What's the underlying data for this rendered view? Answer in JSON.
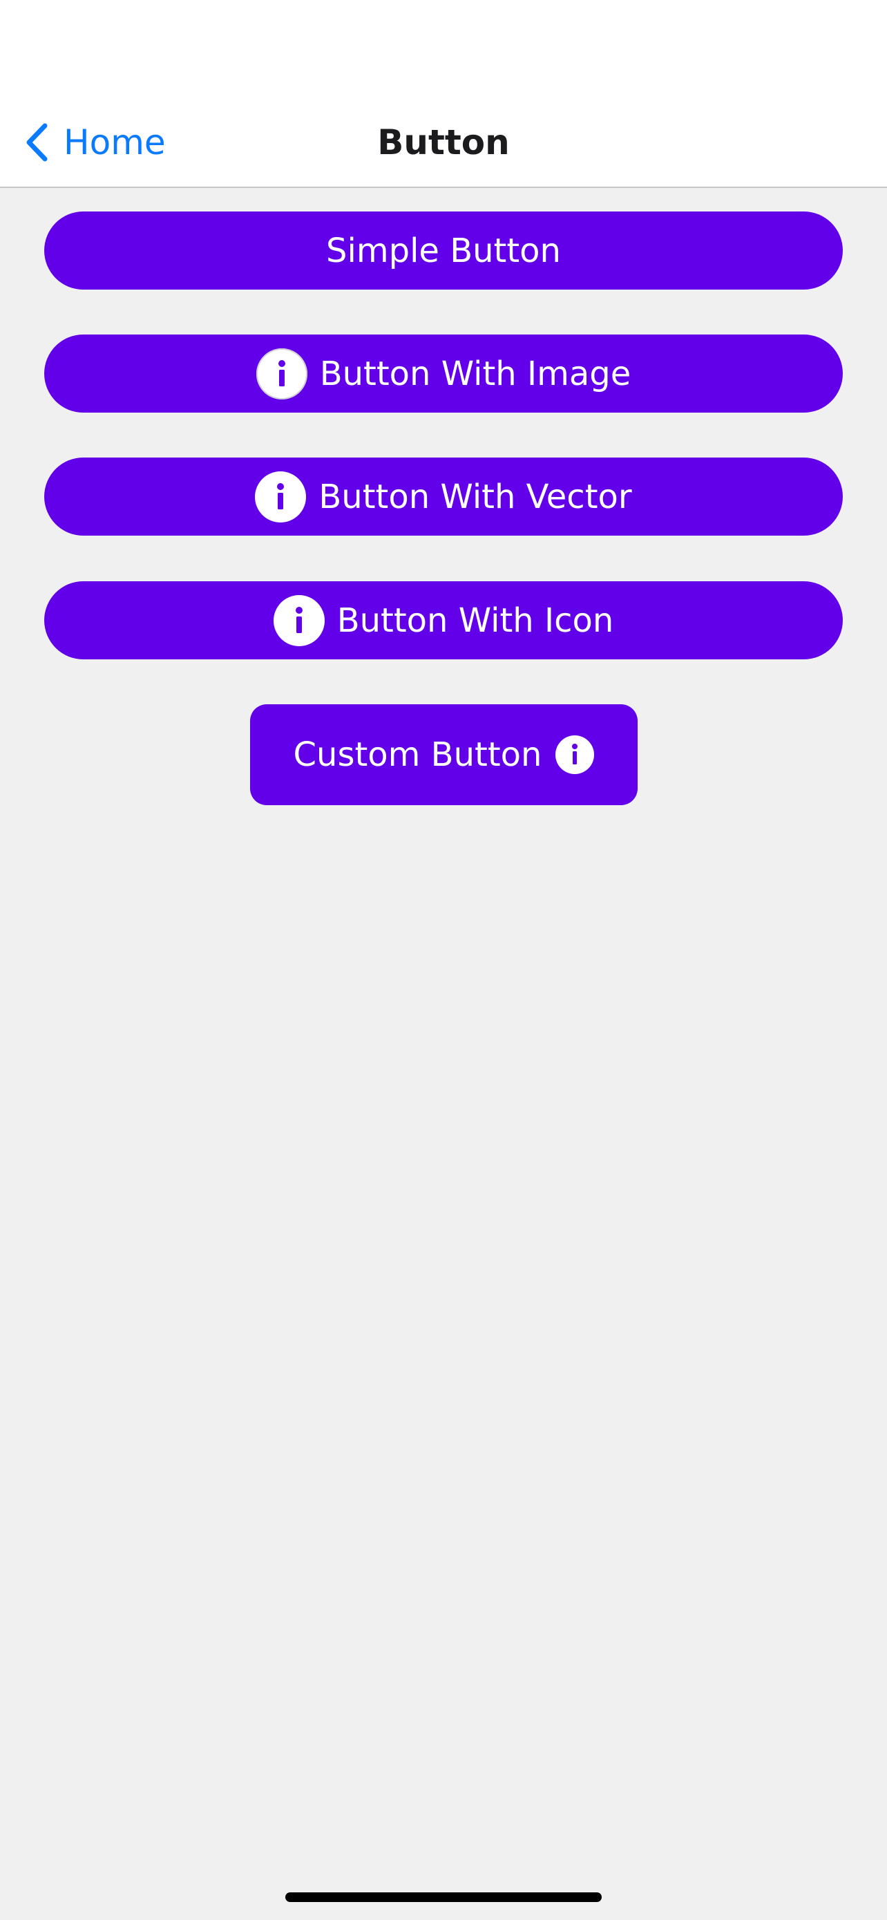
{
  "nav": {
    "back_label": "Home",
    "title": "Button"
  },
  "buttons": {
    "simple": "Simple Button",
    "with_image": "Button With Image",
    "with_vector": "Button With Vector",
    "with_icon": "Button With Icon",
    "custom": "Custom Button"
  },
  "icons": {
    "back": "chevron-left-icon",
    "info": "info-icon"
  },
  "colors": {
    "accent": "#6200ea",
    "link": "#0a7aff",
    "background": "#f0f0f0",
    "nav_background": "#ffffff"
  }
}
